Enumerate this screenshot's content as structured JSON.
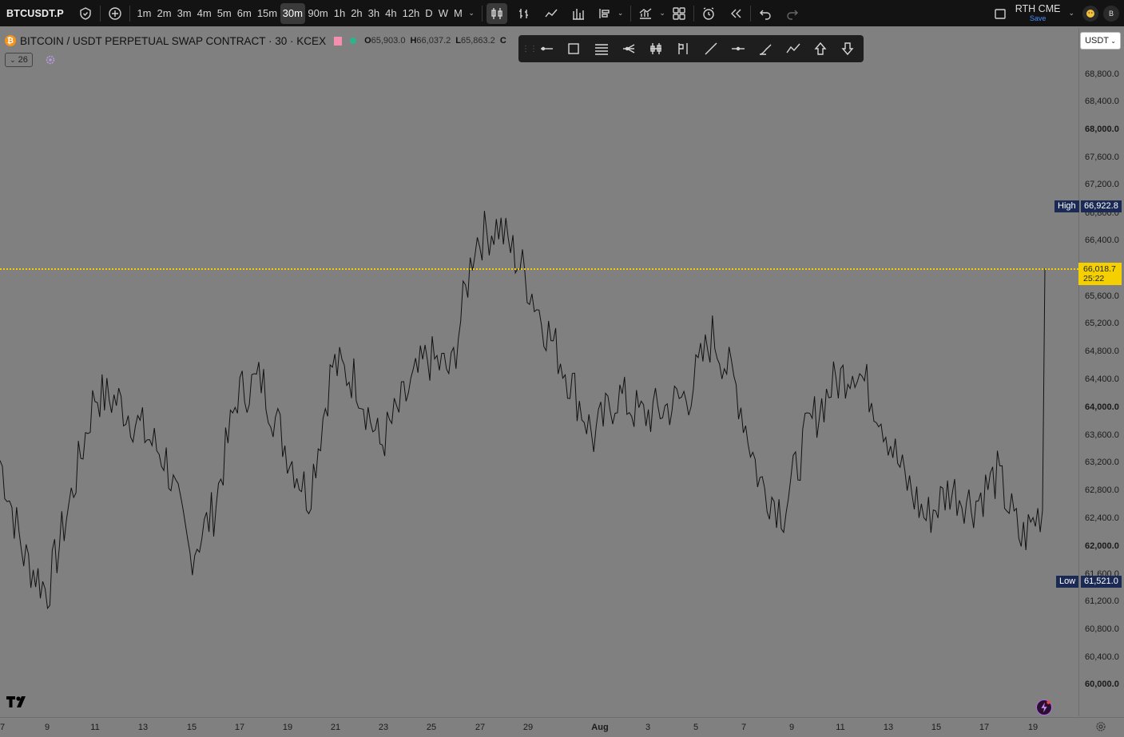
{
  "toolbar": {
    "symbol": "BTCUSDT.P",
    "intervals": [
      "1m",
      "2m",
      "3m",
      "4m",
      "5m",
      "6m",
      "15m",
      "30m",
      "90m",
      "1h",
      "2h",
      "3h",
      "4h",
      "12h",
      "D",
      "W",
      "M"
    ],
    "active_interval": "30m",
    "rth_title": "RTH CME",
    "rth_save": "Save",
    "avatar_letter": "B"
  },
  "legend": {
    "title": "BITCOIN / USDT PERPETUAL SWAP CONTRACT · 30 · KCEX",
    "open_label": "O",
    "open": "65,903.0",
    "high_label": "H",
    "high": "66,037.2",
    "low_label": "L",
    "low": "65,863.2",
    "close_label": "C",
    "indicator_count": "26"
  },
  "price_axis": {
    "currency": "USDT",
    "ticks": [
      "68,800.0",
      "68,400.0",
      "68,000.0",
      "67,600.0",
      "67,200.0",
      "66,800.0",
      "66,400.0",
      "65,600.0",
      "65,200.0",
      "64,800.0",
      "64,400.0",
      "64,000.0",
      "63,600.0",
      "63,200.0",
      "62,800.0",
      "62,400.0",
      "62,000.0",
      "61,600.0",
      "61,200.0",
      "60,800.0",
      "60,400.0",
      "60,000.0"
    ],
    "high_label": "High",
    "high_value": "66,922.8",
    "low_label": "Low",
    "low_value": "61,521.0",
    "last_price": "66,018.7",
    "countdown": "25:22"
  },
  "time_axis": {
    "ticks": [
      "7",
      "9",
      "11",
      "13",
      "15",
      "17",
      "19",
      "21",
      "23",
      "25",
      "27",
      "29",
      "Aug",
      "3",
      "5",
      "7",
      "9",
      "11",
      "13",
      "15",
      "17",
      "19"
    ]
  },
  "chart_data": {
    "type": "line",
    "title": "",
    "xlabel": "",
    "ylabel": "",
    "ylim": [
      59900,
      69300
    ],
    "line_color": "#111111",
    "x": [
      "Jul 7",
      "Jul 8",
      "Jul 9",
      "Jul 10",
      "Jul 11",
      "Jul 12",
      "Jul 13",
      "Jul 14",
      "Jul 15",
      "Jul 16",
      "Jul 17",
      "Jul 18",
      "Jul 19",
      "Jul 20",
      "Jul 21",
      "Jul 22",
      "Jul 23",
      "Jul 24",
      "Jul 25",
      "Jul 26",
      "Jul 27",
      "Jul 28",
      "Jul 29",
      "Jul 30",
      "Jul 31",
      "Aug 1",
      "Aug 2",
      "Aug 3",
      "Aug 4",
      "Aug 5",
      "Aug 6",
      "Aug 7",
      "Aug 8",
      "Aug 9",
      "Aug 10",
      "Aug 11",
      "Aug 12",
      "Aug 13",
      "Aug 14",
      "Aug 15",
      "Aug 16",
      "Aug 17",
      "Aug 18",
      "Aug 19",
      "Aug 19"
    ],
    "series": [
      {
        "values": [
          63400,
          62100,
          61600,
          62900,
          64300,
          64200,
          63800,
          63400,
          62100,
          62700,
          64300,
          64500,
          63600,
          62900,
          64700,
          64500,
          63600,
          64200,
          64800,
          64600,
          66400,
          66600,
          66000,
          65200,
          64500,
          63700,
          64300,
          64000,
          64100,
          64300,
          65100,
          64400,
          63100,
          62700,
          63800,
          64400,
          64700,
          64100,
          63200,
          62600,
          63000,
          62800,
          63200,
          62300,
          62800
        ]
      }
    ]
  }
}
